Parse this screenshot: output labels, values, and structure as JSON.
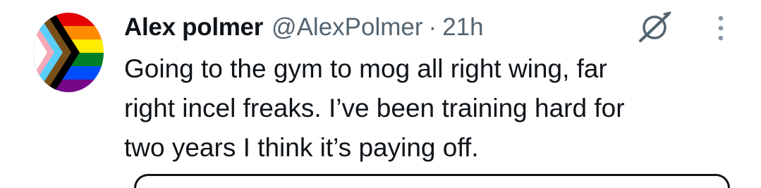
{
  "tweet": {
    "author": {
      "display_name": "Alex polmer",
      "handle": "@AlexPolmer",
      "avatar_icon": "progress-pride-flag-avatar"
    },
    "separator": "·",
    "time": "21h",
    "text_lines": [
      "Going to the gym to mog all right wing, far",
      "right incel freaks. I’ve been training hard for",
      "two years I think it’s paying off."
    ],
    "actions": {
      "grok_icon": "grok-icon",
      "more_icon": "more-vertical-icon"
    }
  },
  "colors": {
    "text_primary": "#0f1419",
    "text_secondary": "#536471"
  }
}
